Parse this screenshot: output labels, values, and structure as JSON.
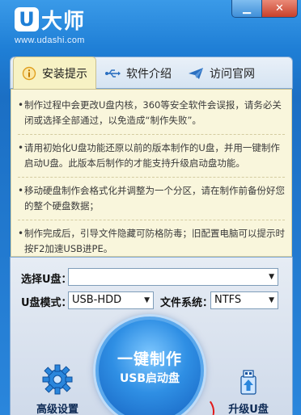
{
  "app": {
    "logo_u": "U",
    "logo_name": "大师",
    "url": "www.udashi.com",
    "min_glyph": "▁",
    "close_glyph": "✕"
  },
  "tabs": [
    {
      "label": "安装提示",
      "icon": "info-icon",
      "active": true
    },
    {
      "label": "软件介绍",
      "icon": "usb-icon",
      "active": false
    },
    {
      "label": "访问官网",
      "icon": "send-icon",
      "active": false
    }
  ],
  "tips": [
    "制作过程中会更改U盘内核，360等安全软件会误报，请务必关闭或选择全部通过，以免造成“制作失败”。",
    "请用初始化U盘功能还原以前的版本制作的U盘，并用一键制作启动U盘。此版本后制作的才能支持升级启动盘功能。",
    "移动硬盘制作会格式化并调整为一个分区，请在制作前备份好您的整个硬盘数据；",
    "制作完成后，引导文件隐藏可防格防毒；旧配置电脑可以提示时按F2加速USB进PE。"
  ],
  "form": {
    "select_u_label": "选择U盘：",
    "select_u_value": "",
    "mode_label": "U盘模式：",
    "mode_value": "USB-HDD",
    "fs_label": "文件系统：",
    "fs_value": "NTFS"
  },
  "actions": {
    "advanced_label": "高级设置",
    "make_line1": "一键制作",
    "make_line2": "USB启动盘",
    "upgrade_label": "升级U盘"
  },
  "colors": {
    "accent": "#1f7fd6",
    "panel_bg": "#f9f6dc",
    "close_red": "#c8402a",
    "annotation_red": "#e21a1a"
  }
}
